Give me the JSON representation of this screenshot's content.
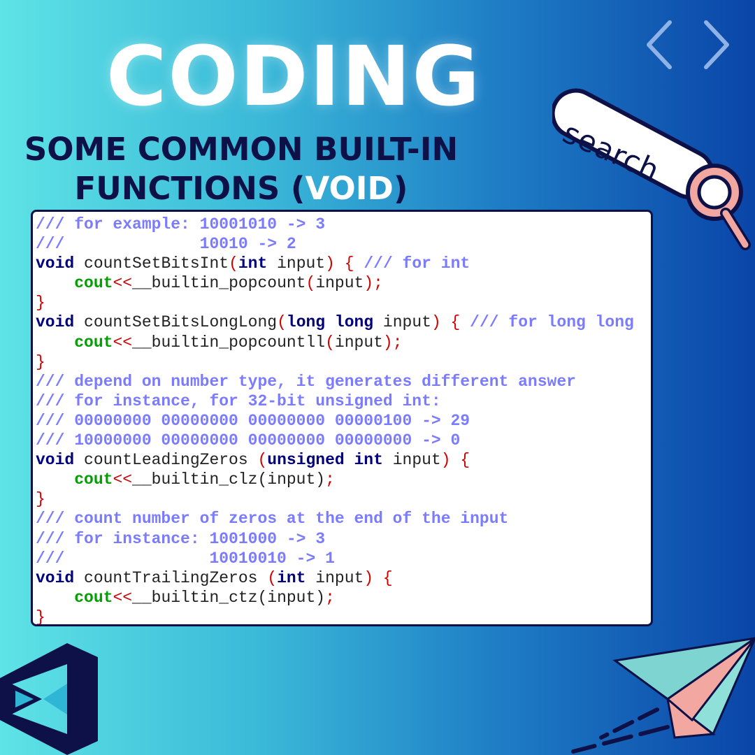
{
  "title": "CODING",
  "subtitle": {
    "line1": "SOME COMMON BUILT-IN",
    "line2_before": "FUNCTIONS (",
    "line2_accent": "VOID",
    "line2_after": ")"
  },
  "search_bar": {
    "label": "search"
  },
  "icons": [
    "code-brackets-icon",
    "search-bar-icon",
    "magnifier-icon",
    "visual-studio-logo-icon",
    "paper-plane-icon"
  ],
  "colors": {
    "background_left": "#5ee3e6",
    "background_right": "#0a45a8",
    "title": "#ffffff",
    "subtitle": "#0d1147",
    "comment": "#7b7bff",
    "keyword": "#00007a",
    "cout": "#00a000",
    "punctuation": "#d00000"
  },
  "code": [
    [
      {
        "t": "c",
        "v": "/// for example: 10001010 -> 3"
      }
    ],
    [
      {
        "t": "c",
        "v": "///              10010 -> 2"
      }
    ],
    [
      {
        "t": "k",
        "v": "void"
      },
      {
        "t": "p",
        "v": " countSetBitsInt"
      },
      {
        "t": "r",
        "v": "("
      },
      {
        "t": "k",
        "v": "int"
      },
      {
        "t": "p",
        "v": " input"
      },
      {
        "t": "r",
        "v": ") {"
      },
      {
        "t": "c",
        "v": " /// for int"
      }
    ],
    [
      {
        "t": "p",
        "v": "    "
      },
      {
        "t": "g",
        "v": "cout"
      },
      {
        "t": "r",
        "v": "<<"
      },
      {
        "t": "p",
        "v": "__builtin_popcount"
      },
      {
        "t": "r",
        "v": "("
      },
      {
        "t": "p",
        "v": "input"
      },
      {
        "t": "r",
        "v": ");"
      }
    ],
    [
      {
        "t": "r",
        "v": "}"
      }
    ],
    [
      {
        "t": "k",
        "v": "void"
      },
      {
        "t": "p",
        "v": " countSetBitsLongLong"
      },
      {
        "t": "r",
        "v": "("
      },
      {
        "t": "k",
        "v": "long long"
      },
      {
        "t": "p",
        "v": " input"
      },
      {
        "t": "r",
        "v": ") {"
      },
      {
        "t": "c",
        "v": " /// for long long"
      }
    ],
    [
      {
        "t": "p",
        "v": "    "
      },
      {
        "t": "g",
        "v": "cout"
      },
      {
        "t": "r",
        "v": "<<"
      },
      {
        "t": "p",
        "v": "__builtin_popcountll"
      },
      {
        "t": "r",
        "v": "("
      },
      {
        "t": "p",
        "v": "input"
      },
      {
        "t": "r",
        "v": ");"
      }
    ],
    [
      {
        "t": "r",
        "v": "}"
      }
    ],
    [
      {
        "t": "c",
        "v": "/// depend on number type, it generates different answer"
      }
    ],
    [
      {
        "t": "c",
        "v": "/// for instance, for 32-bit unsigned int:"
      }
    ],
    [
      {
        "t": "c",
        "v": "/// 00000000 00000000 00000000 00000100 -> 29"
      }
    ],
    [
      {
        "t": "c",
        "v": "/// 10000000 00000000 00000000 00000000 -> 0"
      }
    ],
    [
      {
        "t": "k",
        "v": "void"
      },
      {
        "t": "p",
        "v": " countLeadingZeros "
      },
      {
        "t": "r",
        "v": "("
      },
      {
        "t": "k",
        "v": "unsigned int"
      },
      {
        "t": "p",
        "v": " input"
      },
      {
        "t": "r",
        "v": ") {"
      }
    ],
    [
      {
        "t": "p",
        "v": "    "
      },
      {
        "t": "g",
        "v": "cout"
      },
      {
        "t": "r",
        "v": "<<"
      },
      {
        "t": "p",
        "v": "__builtin_clz(input)"
      },
      {
        "t": "r",
        "v": ";"
      }
    ],
    [
      {
        "t": "r",
        "v": "}"
      }
    ],
    [
      {
        "t": "c",
        "v": "/// count number of zeros at the end of the input"
      }
    ],
    [
      {
        "t": "c",
        "v": "/// for instance: 1001000 -> 3"
      }
    ],
    [
      {
        "t": "c",
        "v": "///               10010010 -> 1"
      }
    ],
    [
      {
        "t": "k",
        "v": "void"
      },
      {
        "t": "p",
        "v": " countTrailingZeros "
      },
      {
        "t": "r",
        "v": "("
      },
      {
        "t": "k",
        "v": "int"
      },
      {
        "t": "p",
        "v": " input"
      },
      {
        "t": "r",
        "v": ") {"
      }
    ],
    [
      {
        "t": "p",
        "v": "    "
      },
      {
        "t": "g",
        "v": "cout"
      },
      {
        "t": "r",
        "v": "<<"
      },
      {
        "t": "p",
        "v": "__builtin_ctz(input)"
      },
      {
        "t": "r",
        "v": ";"
      }
    ],
    [
      {
        "t": "r",
        "v": "}"
      }
    ]
  ]
}
